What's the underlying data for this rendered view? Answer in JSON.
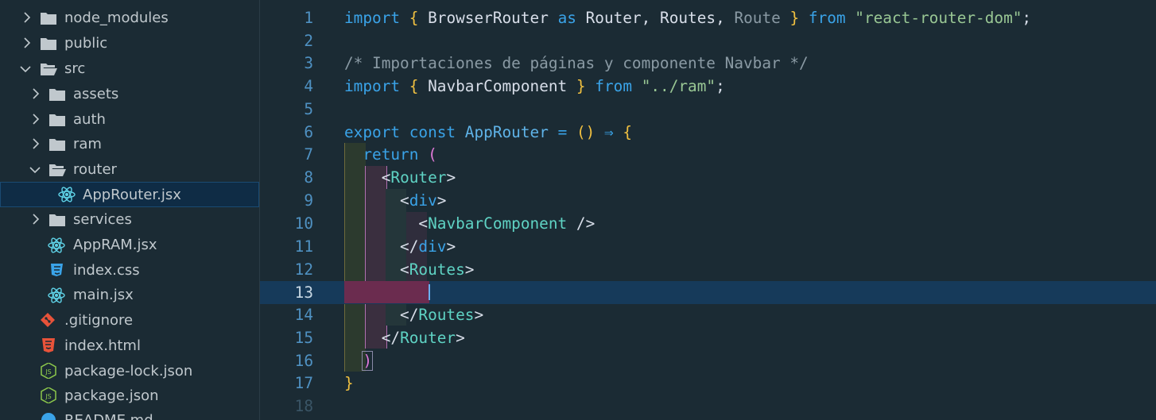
{
  "explorer": {
    "items": [
      {
        "label": "node_modules",
        "type": "folder",
        "state": "collapsed"
      },
      {
        "label": "public",
        "type": "folder",
        "state": "collapsed"
      },
      {
        "label": "src",
        "type": "folder",
        "state": "expanded"
      },
      {
        "label": "assets",
        "type": "folder",
        "state": "collapsed"
      },
      {
        "label": "auth",
        "type": "folder",
        "state": "collapsed"
      },
      {
        "label": "ram",
        "type": "folder",
        "state": "collapsed"
      },
      {
        "label": "router",
        "type": "folder",
        "state": "expanded"
      },
      {
        "label": "AppRouter.jsx",
        "type": "react-file",
        "state": "selected"
      },
      {
        "label": "services",
        "type": "folder",
        "state": "collapsed"
      },
      {
        "label": "AppRAM.jsx",
        "type": "react-file"
      },
      {
        "label": "index.css",
        "type": "css-file"
      },
      {
        "label": "main.jsx",
        "type": "react-file"
      },
      {
        "label": ".gitignore",
        "type": "git-file"
      },
      {
        "label": "index.html",
        "type": "html-file"
      },
      {
        "label": "package-lock.json",
        "type": "json-file"
      },
      {
        "label": "package.json",
        "type": "json-file"
      },
      {
        "label": "README.md",
        "type": "info-file"
      }
    ]
  },
  "editor": {
    "current_line": 13,
    "lines": [
      {
        "n": "1"
      },
      {
        "n": "2"
      },
      {
        "n": "3"
      },
      {
        "n": "4"
      },
      {
        "n": "5"
      },
      {
        "n": "6"
      },
      {
        "n": "7"
      },
      {
        "n": "8"
      },
      {
        "n": "9"
      },
      {
        "n": "10"
      },
      {
        "n": "11"
      },
      {
        "n": "12"
      },
      {
        "n": "13"
      },
      {
        "n": "14"
      },
      {
        "n": "15"
      },
      {
        "n": "16"
      },
      {
        "n": "17"
      },
      {
        "n": "18"
      }
    ],
    "tokens": {
      "import": "import",
      "browser_router": "BrowserRouter",
      "as": "as",
      "router": "Router",
      "routes": "Routes",
      "route": "Route",
      "from": "from",
      "rrd_module": "\"react-router-dom\"",
      "comment": "/* Importaciones de páginas y componente Navbar */",
      "navbar_component": "NavbarComponent",
      "ram_module": "\"../ram\"",
      "export": "export",
      "const": "const",
      "app_router": "AppRouter",
      "arrow": "⇒",
      "return": "return",
      "div": "div"
    }
  },
  "colors": {
    "background": "#1b2b34",
    "current_line": "#163a5a",
    "keyword": "#3aa3e8",
    "string": "#99c794",
    "tag": "#5fd3c4",
    "bracket_gold": "#f0c040",
    "bracket_pink": "#e07ad8"
  }
}
